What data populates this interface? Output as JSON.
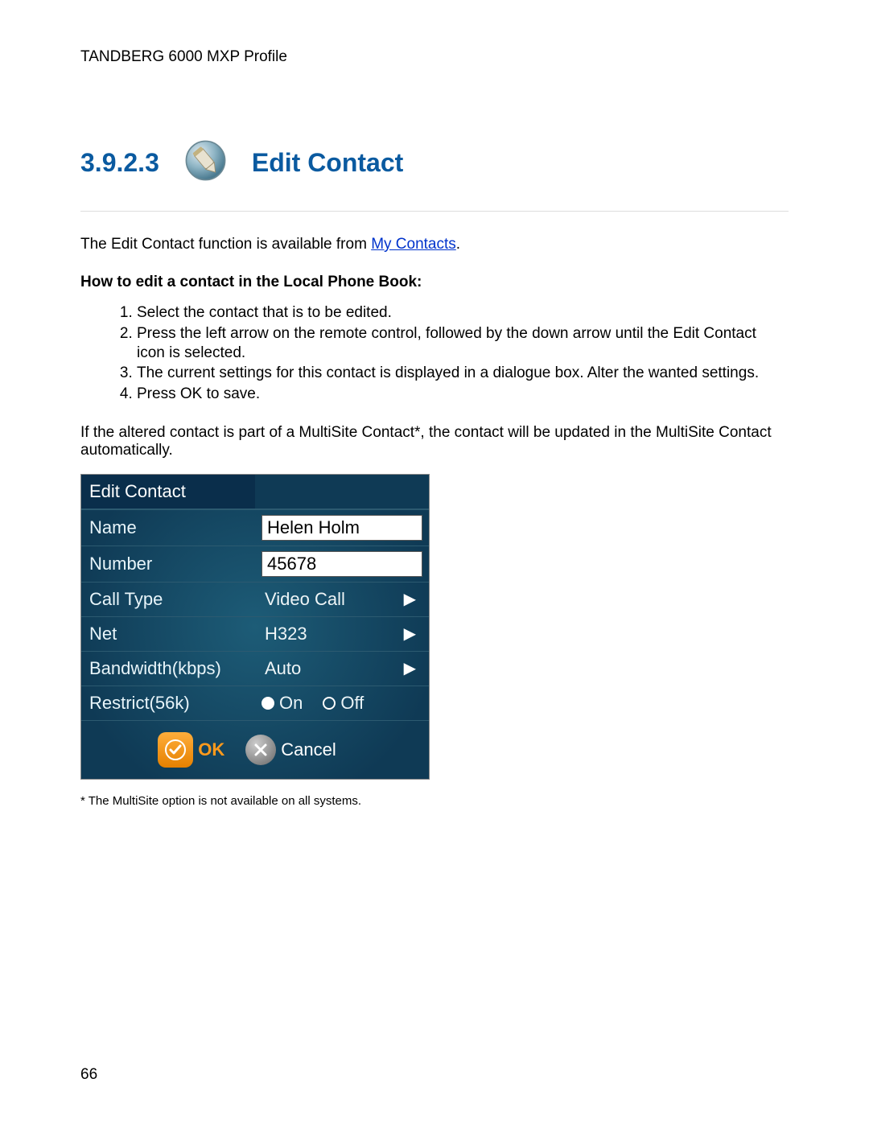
{
  "header": {
    "product": "TANDBERG 6000 MXP Profile"
  },
  "section": {
    "number": "3.9.2.3",
    "title": "Edit Contact",
    "icon": "pencil-edit-icon"
  },
  "intro": {
    "prefix": "The Edit Contact function is available from ",
    "link_text": "My Contacts",
    "suffix": "."
  },
  "howto": {
    "heading": "How to edit a contact in the Local Phone Book:",
    "steps": [
      "Select the contact that is to be edited.",
      "Press the left arrow on the remote control, followed by the down arrow until the Edit Contact icon is selected.",
      "The current settings for this contact is displayed in a dialogue box. Alter the wanted settings.",
      "Press OK to save."
    ]
  },
  "post_note": "If the altered contact is part of a MultiSite Contact*, the contact will be updated in the MultiSite Contact automatically.",
  "dialog": {
    "title": "Edit Contact",
    "fields": {
      "name_label": "Name",
      "name_value": "Helen Holm",
      "number_label": "Number",
      "number_value": "45678",
      "calltype_label": "Call Type",
      "calltype_value": "Video Call",
      "net_label": "Net",
      "net_value": "H323",
      "bandwidth_label": "Bandwidth(kbps)",
      "bandwidth_value": "Auto",
      "restrict_label": "Restrict(56k)",
      "restrict_on": "On",
      "restrict_off": "Off"
    },
    "buttons": {
      "ok": "OK",
      "cancel": "Cancel"
    }
  },
  "footnote": "* The MultiSite option is not available on all systems.",
  "page_number": "66"
}
